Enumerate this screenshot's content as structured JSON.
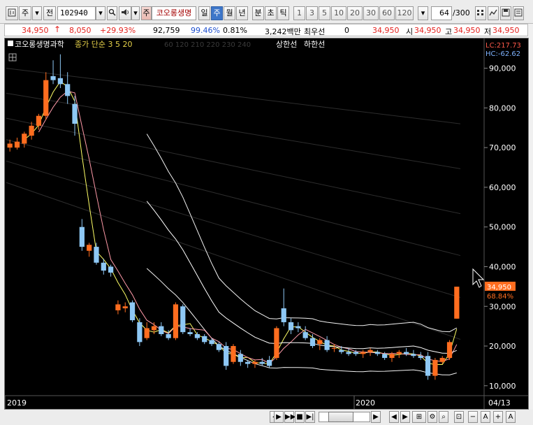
{
  "toolbar": {
    "type_select": "주",
    "prev_label": "전",
    "stock_code": "102940",
    "stock_badge": "주",
    "stock_name": "코오롱생명",
    "periods": [
      "일",
      "주",
      "월",
      "년",
      "분",
      "초",
      "틱"
    ],
    "active_period": "주",
    "intervals": [
      "1",
      "3",
      "5",
      "10",
      "20",
      "30",
      "60",
      "120"
    ],
    "page_counter": "64",
    "page_total": "/300"
  },
  "quote": {
    "price": "34,950",
    "change": "8,050",
    "change_rate": "+29.93%",
    "volume": "92,759",
    "volume_ratio": "99.46%",
    "turnover_rate": "0.81%",
    "amount": "3,242백만",
    "preferred_label": "최우선",
    "preferred_value": "0",
    "current_price": "34,950",
    "open_label": "시",
    "open": "34,950",
    "high_label": "고",
    "high": "34,950",
    "low_label": "저",
    "low": "34,950"
  },
  "chart_legend": {
    "name": "코오롱생명과학",
    "ma_label": "종가 단순 3 5 20",
    "long_ma_label": "60 120 210 220 230 240",
    "limit_up": "상한선",
    "limit_down": "하한선"
  },
  "chart_data": {
    "type": "candlestick",
    "y_ticks": [
      "90,000",
      "80,000",
      "70,000",
      "60,000",
      "50,000",
      "40,000",
      "30,000",
      "20,000",
      "10,000"
    ],
    "ylim": [
      7500,
      97500
    ],
    "x_labels": [
      "2019",
      "2020",
      "04/13"
    ],
    "lc_label": "LC:217.73",
    "hc_label": "HC:-62.62",
    "price_tag": "34,950",
    "pct_tag": "68.84%",
    "candles": [
      {
        "o": 70000,
        "h": 72000,
        "l": 69000,
        "c": 71000
      },
      {
        "o": 70000,
        "h": 72500,
        "l": 69500,
        "c": 71500
      },
      {
        "o": 71000,
        "h": 74000,
        "l": 70000,
        "c": 73500
      },
      {
        "o": 73000,
        "h": 76500,
        "l": 72000,
        "c": 75500
      },
      {
        "o": 75500,
        "h": 78500,
        "l": 74500,
        "c": 78000
      },
      {
        "o": 78000,
        "h": 89000,
        "l": 77000,
        "c": 87000
      },
      {
        "o": 88000,
        "h": 92000,
        "l": 86000,
        "c": 87000
      },
      {
        "o": 87500,
        "h": 93500,
        "l": 85000,
        "c": 86000
      },
      {
        "o": 86000,
        "h": 89000,
        "l": 81000,
        "c": 83000
      },
      {
        "o": 81000,
        "h": 83000,
        "l": 73000,
        "c": 76000
      },
      {
        "o": 50000,
        "h": 52000,
        "l": 44000,
        "c": 45000
      },
      {
        "o": 44000,
        "h": 46000,
        "l": 42500,
        "c": 45500
      },
      {
        "o": 45000,
        "h": 46000,
        "l": 40500,
        "c": 41000
      },
      {
        "o": 41000,
        "h": 42000,
        "l": 38000,
        "c": 39000
      },
      {
        "o": 40000,
        "h": 40500,
        "l": 37500,
        "c": 38500
      },
      {
        "o": 29000,
        "h": 31500,
        "l": 28000,
        "c": 30500
      },
      {
        "o": 29500,
        "h": 31000,
        "l": 28500,
        "c": 30000
      },
      {
        "o": 31000,
        "h": 31500,
        "l": 26000,
        "c": 26500
      },
      {
        "o": 26000,
        "h": 27000,
        "l": 20000,
        "c": 21000
      },
      {
        "o": 22000,
        "h": 26000,
        "l": 21500,
        "c": 24500
      },
      {
        "o": 24000,
        "h": 26000,
        "l": 23000,
        "c": 25000
      },
      {
        "o": 25000,
        "h": 26000,
        "l": 22500,
        "c": 23000
      },
      {
        "o": 23000,
        "h": 24000,
        "l": 21500,
        "c": 22000
      },
      {
        "o": 22000,
        "h": 31000,
        "l": 21500,
        "c": 30500
      },
      {
        "o": 30000,
        "h": 30500,
        "l": 23000,
        "c": 23500
      },
      {
        "o": 23500,
        "h": 24500,
        "l": 22500,
        "c": 23000
      },
      {
        "o": 23000,
        "h": 23500,
        "l": 21500,
        "c": 22000
      },
      {
        "o": 22500,
        "h": 23000,
        "l": 20500,
        "c": 21000
      },
      {
        "o": 21500,
        "h": 22000,
        "l": 20000,
        "c": 20500
      },
      {
        "o": 20500,
        "h": 21000,
        "l": 18500,
        "c": 19000
      },
      {
        "o": 20000,
        "h": 21000,
        "l": 14000,
        "c": 15000
      },
      {
        "o": 16000,
        "h": 20500,
        "l": 15500,
        "c": 20000
      },
      {
        "o": 18000,
        "h": 19000,
        "l": 15000,
        "c": 16000
      },
      {
        "o": 16000,
        "h": 16500,
        "l": 14500,
        "c": 15500
      },
      {
        "o": 15500,
        "h": 16500,
        "l": 14500,
        "c": 16000
      },
      {
        "o": 16000,
        "h": 17000,
        "l": 15000,
        "c": 15500
      },
      {
        "o": 16500,
        "h": 17500,
        "l": 14500,
        "c": 15000
      },
      {
        "o": 17000,
        "h": 25000,
        "l": 16500,
        "c": 24500
      },
      {
        "o": 29500,
        "h": 34500,
        "l": 25000,
        "c": 26000
      },
      {
        "o": 26000,
        "h": 27000,
        "l": 23000,
        "c": 24000
      },
      {
        "o": 25000,
        "h": 26000,
        "l": 23500,
        "c": 24500
      },
      {
        "o": 23500,
        "h": 25000,
        "l": 21500,
        "c": 22000
      },
      {
        "o": 22000,
        "h": 23000,
        "l": 19500,
        "c": 20000
      },
      {
        "o": 20500,
        "h": 22000,
        "l": 19000,
        "c": 21500
      },
      {
        "o": 21500,
        "h": 22500,
        "l": 18500,
        "c": 19000
      },
      {
        "o": 19500,
        "h": 20500,
        "l": 18500,
        "c": 19500
      },
      {
        "o": 19000,
        "h": 20000,
        "l": 18000,
        "c": 18500
      },
      {
        "o": 18500,
        "h": 19500,
        "l": 17500,
        "c": 18000
      },
      {
        "o": 18500,
        "h": 19000,
        "l": 17500,
        "c": 18000
      },
      {
        "o": 18000,
        "h": 19000,
        "l": 17000,
        "c": 18500
      },
      {
        "o": 18500,
        "h": 19500,
        "l": 17500,
        "c": 19000
      },
      {
        "o": 18500,
        "h": 19000,
        "l": 17500,
        "c": 18000
      },
      {
        "o": 18000,
        "h": 18500,
        "l": 16500,
        "c": 17000
      },
      {
        "o": 17000,
        "h": 18500,
        "l": 16000,
        "c": 18000
      },
      {
        "o": 18000,
        "h": 19000,
        "l": 17000,
        "c": 18500
      },
      {
        "o": 18500,
        "h": 19500,
        "l": 17500,
        "c": 18000
      },
      {
        "o": 18000,
        "h": 19000,
        "l": 17000,
        "c": 17500
      },
      {
        "o": 17500,
        "h": 18500,
        "l": 16500,
        "c": 17000
      },
      {
        "o": 17500,
        "h": 18500,
        "l": 11500,
        "c": 12500
      },
      {
        "o": 12500,
        "h": 17000,
        "l": 11500,
        "c": 16500
      },
      {
        "o": 16000,
        "h": 17500,
        "l": 15500,
        "c": 17000
      },
      {
        "o": 17000,
        "h": 21500,
        "l": 16500,
        "c": 21000
      },
      {
        "o": 26900,
        "h": 34950,
        "l": 26900,
        "c": 34950
      }
    ]
  },
  "colors": {
    "up": "#ff6d1f",
    "down": "#8ec8f5",
    "ma3": "#ffff66",
    "ma5": "#ff9aa8",
    "ma20": "#ffffff"
  },
  "icons": {
    "chart_type": "candle-icon",
    "sound": "speaker-icon",
    "tools": "drawing-tools-icon"
  }
}
